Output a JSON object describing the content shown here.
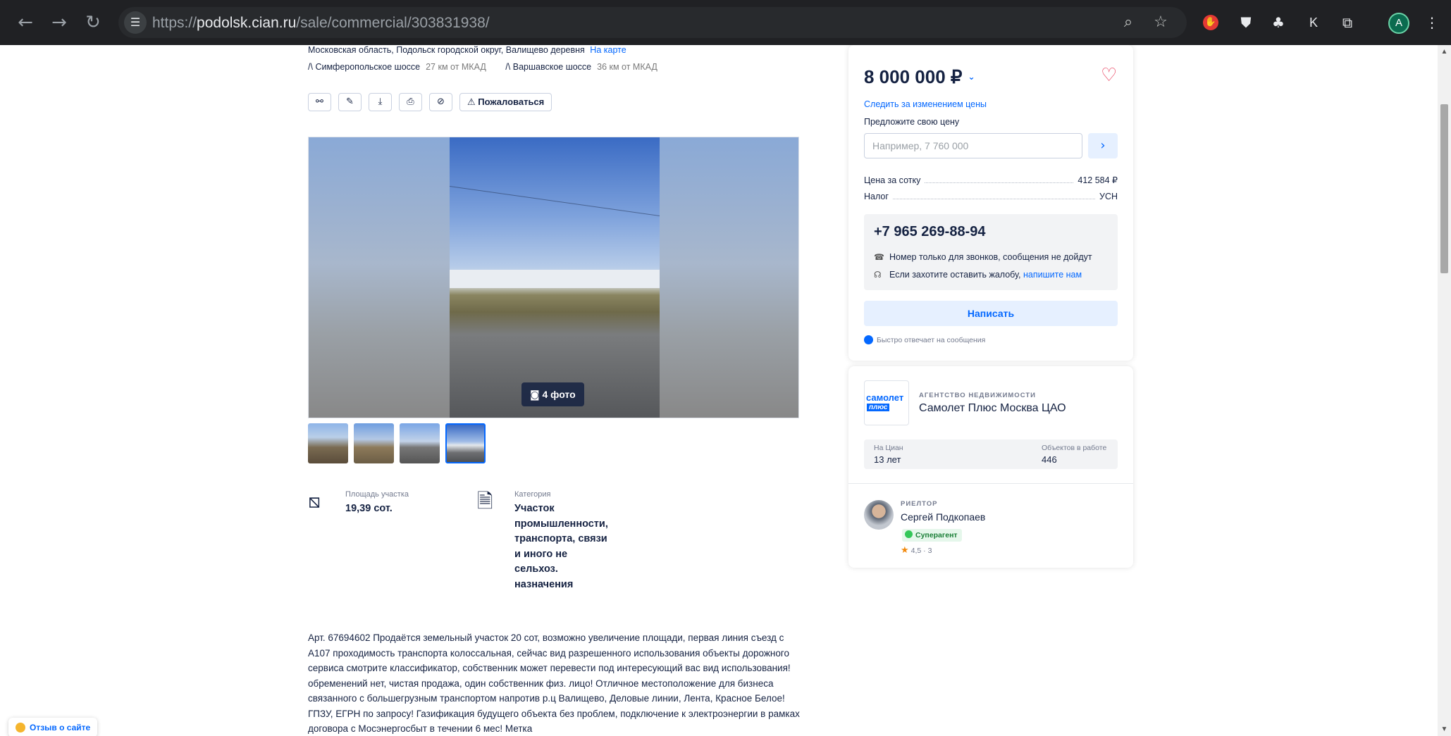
{
  "browser": {
    "url_scheme": "https://",
    "url_host": "podolsk.cian.ru",
    "url_path": "/sale/commercial/303831938/",
    "profile_initial": "A",
    "ext_k": "K"
  },
  "listing": {
    "address": "Московская область, Подольск городской округ, Валищево деревня",
    "map_link": "На карте",
    "highways": [
      {
        "name": "Симферопольское шоссе",
        "distance": "27 км от МКАД"
      },
      {
        "name": "Варшавское шоссе",
        "distance": "36 км от МКАД"
      }
    ],
    "highway_icon": "/\\",
    "complain_label": "Пожаловаться",
    "photo_count": "4 фото",
    "features": [
      {
        "label": "Площадь участка",
        "value": "19,39 сот."
      },
      {
        "label": "Категория",
        "value": "Участок промышленности, транспорта, связи и иного не сельхоз. назначения"
      }
    ],
    "description": "Арт. 67694602 Продаётся земельный участок 20 сот, возможно увеличение площади, первая линия съезд с А107 проходимость транспорта колоссальная, сейчас вид разрешенного использования объекты дорожного сервиса смотрите классификатор, собственник может перевести под интересующий вас вид использования! обременений нет, чистая продажа, один собственник физ. лицо! Отличное местоположение для бизнеса связанного с большегрузным транспортом напротив р.ц Валищево, Деловые линии, Лента, Красное Белое! ГПЗУ, ЕГРН по запросу! Газификация будущего объекта без проблем, подключение к электроэнергии в рамках договора с Мосэнергосбыт в течении 6 мес! Метка"
  },
  "price_card": {
    "price": "8 000 000 ₽",
    "follow_price": "Следить за изменением цены",
    "offer_label": "Предложите свою цену",
    "offer_placeholder": "Например, 7 760 000",
    "price_per_sotka_label": "Цена за сотку",
    "price_per_sotka_value": "412 584 ₽",
    "tax_label": "Налог",
    "tax_value": "УСН",
    "phone": "+7 965 269-88-94",
    "phone_note": "Номер только для звонков, сообщения не дойдут",
    "complaint_prefix": "Если захотите оставить жалобу,",
    "complaint_link": "напишите нам",
    "write_button": "Написать",
    "fast_reply": "Быстро отвечает на сообщения"
  },
  "agency": {
    "logo_line1": "самолет",
    "logo_line2": "плюс",
    "type": "АГЕНТСТВО НЕДВИЖИМОСТИ",
    "name": "Самолет Плюс Москва ЦАО",
    "on_cian_label": "На Циан",
    "on_cian_value": "13 лет",
    "objects_label": "Объектов в работе",
    "objects_value": "446"
  },
  "agent": {
    "role": "РИЕЛТОР",
    "name": "Сергей Подкопаев",
    "badge": "Суперагент",
    "rating": "4,5 · 3"
  },
  "feedback": {
    "label": "Отзыв о сайте"
  }
}
